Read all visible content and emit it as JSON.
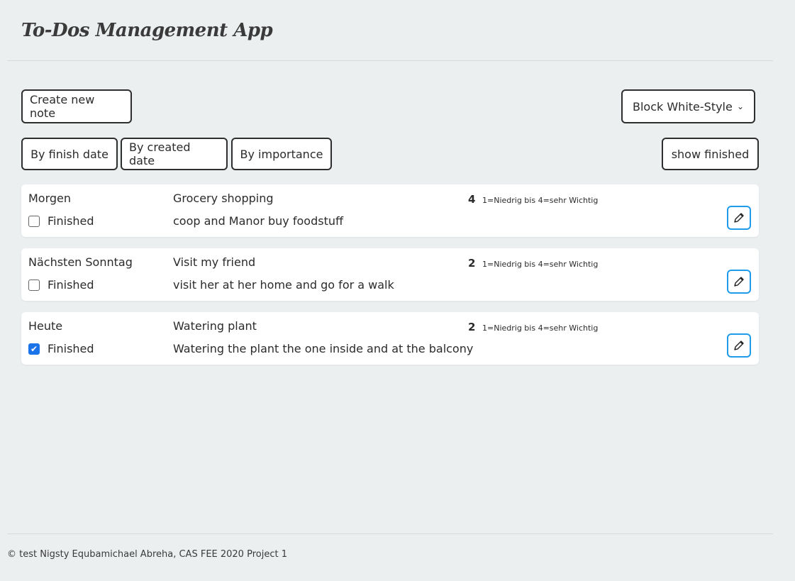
{
  "app": {
    "title": "To-Dos Management App"
  },
  "toolbar": {
    "create_label": "Create new note",
    "style_value": "Block White-Style",
    "sort_finish_label": "By finish date",
    "sort_created_label": "By created date",
    "sort_importance_label": "By importance",
    "show_finished_label": "show finished"
  },
  "todos": [
    {
      "due": "Morgen",
      "finished_label": "Finished",
      "finished": false,
      "title": "Grocery shopping",
      "description": "coop and Manor buy foodstuff",
      "importance": "4",
      "importance_hint": "1=Niedrig bis 4=sehr Wichtig"
    },
    {
      "due": "Nächsten Sonntag",
      "finished_label": "Finished",
      "finished": false,
      "title": "Visit my friend",
      "description": "visit her at her home and go for a walk",
      "importance": "2",
      "importance_hint": "1=Niedrig bis 4=sehr Wichtig"
    },
    {
      "due": "Heute",
      "finished_label": "Finished",
      "finished": true,
      "title": "Watering plant",
      "description": "Watering the plant the one inside and at the balcony",
      "importance": "2",
      "importance_hint": "1=Niedrig bis 4=sehr Wichtig"
    }
  ],
  "footer": {
    "copyright": "© test Nigsty Equbamichael Abreha, CAS FEE 2020 Project 1"
  },
  "colors": {
    "background": "#ebeff0",
    "edit_border": "#1e9bea",
    "checkbox_checked": "#1a73e8"
  },
  "icons": {
    "edit": "pencil-icon",
    "select": "chevron-down-icon",
    "checkbox": "checkbox-icon"
  }
}
